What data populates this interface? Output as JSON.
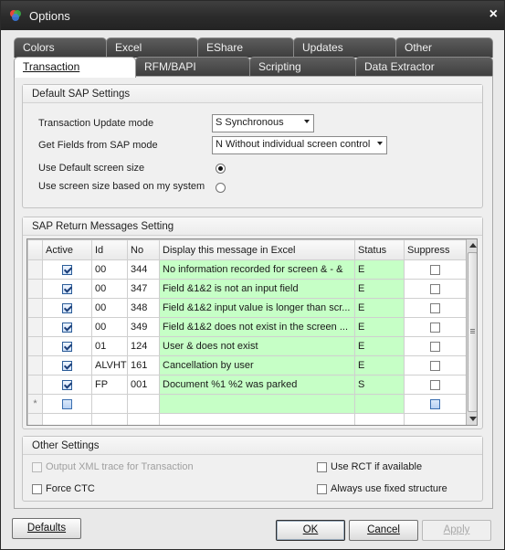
{
  "window": {
    "title": "Options",
    "close_glyph": "×"
  },
  "tabs_row1": [
    {
      "label": "Colors"
    },
    {
      "label": "Excel"
    },
    {
      "label": "EShare"
    },
    {
      "label": "Updates"
    },
    {
      "label": "Other"
    }
  ],
  "tabs_row2": [
    {
      "label": "Transaction",
      "active": true
    },
    {
      "label": "RFM/BAPI"
    },
    {
      "label": "Scripting"
    },
    {
      "label": "Data Extractor"
    }
  ],
  "default_sap": {
    "title": "Default SAP Settings",
    "txn_mode_label": "Transaction Update mode",
    "txn_mode_value": "S Synchronous",
    "fields_mode_label": "Get Fields from SAP mode",
    "fields_mode_value": "N Without individual screen control",
    "default_screen_label": "Use Default screen size",
    "system_screen_label": "Use screen size based on my system",
    "default_screen_selected": true
  },
  "return_messages": {
    "title": "SAP Return Messages Setting",
    "columns": [
      "Active",
      "Id",
      "No",
      "Display this message in Excel",
      "Status",
      "Suppress"
    ],
    "rows": [
      {
        "active": true,
        "id": "00",
        "no": "344",
        "message": "No information recorded for screen & - &",
        "status": "E",
        "suppress": false
      },
      {
        "active": true,
        "id": "00",
        "no": "347",
        "message": "Field &1&2 is not an input field",
        "status": "E",
        "suppress": false
      },
      {
        "active": true,
        "id": "00",
        "no": "348",
        "message": "Field &1&2 input value is longer than scr...",
        "status": "E",
        "suppress": false
      },
      {
        "active": true,
        "id": "00",
        "no": "349",
        "message": "Field &1&2 does not exist in the screen ...",
        "status": "E",
        "suppress": false
      },
      {
        "active": true,
        "id": "01",
        "no": "124",
        "message": "User & does not exist",
        "status": "E",
        "suppress": false
      },
      {
        "active": true,
        "id": "ALVHT",
        "no": "161",
        "message": "Cancellation by user",
        "status": "E",
        "suppress": false
      },
      {
        "active": true,
        "id": "FP",
        "no": "001",
        "message": "Document %1 %2 was parked",
        "status": "S",
        "suppress": false
      }
    ],
    "new_row_marker": "*"
  },
  "other_settings": {
    "title": "Other Settings",
    "xml_trace_label": "Output XML trace for Transaction",
    "force_ctc_label": "Force CTC",
    "use_rct_label": "Use RCT if available",
    "fixed_structure_label": "Always use fixed structure"
  },
  "buttons": {
    "defaults": "Defaults",
    "ok": "OK",
    "cancel": "Cancel",
    "apply": "Apply"
  }
}
